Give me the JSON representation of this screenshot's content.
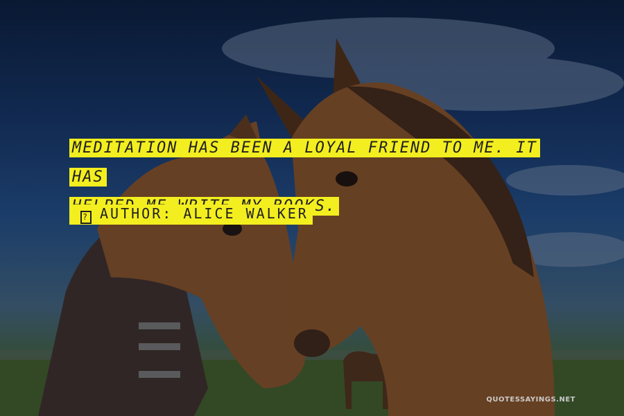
{
  "quote": {
    "line1": "MEDITATION HAS BEEN A LOYAL FRIEND TO ME. IT HAS",
    "line2": "HELPED ME WRITE MY BOOKS."
  },
  "author": {
    "glyph": "?",
    "label": "AUTHOR: ALICE WALKER"
  },
  "watermark": "QUOTESSAYINGS.NET",
  "colors": {
    "highlight": "#f3ee1f",
    "text": "#1f1f1f",
    "sky": "#14305a",
    "horse": "#7a4a22"
  }
}
